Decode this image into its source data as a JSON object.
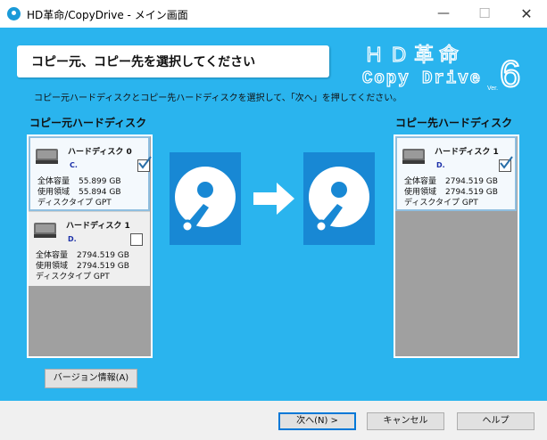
{
  "window": {
    "title": "HD革命/CopyDrive - メイン画面",
    "min_glyph": "—",
    "max_glyph": "☐",
    "close_glyph": "✕"
  },
  "heading": "コピー元、コピー先を選択してください",
  "logo": {
    "line1": "ＨＤ革命",
    "line2": "Copy Drive",
    "ver": "Ver.",
    "version": "6"
  },
  "instruction": "コピー元ハードディスクとコピー先ハードディスクを選択して、「次へ」を押してください。",
  "source": {
    "title": "コピー元ハードディスク",
    "disks": [
      {
        "name": "ハードディスク 0",
        "letter": "C.",
        "checked": true,
        "total_label": "全体容量",
        "total": "55.899 GB",
        "used_label": "使用領域",
        "used": "55.894 GB",
        "type_label": "ディスクタイプ",
        "type": "GPT"
      },
      {
        "name": "ハードディスク 1",
        "letter": "D.",
        "checked": false,
        "total_label": "全体容量",
        "total": "2794.519 GB",
        "used_label": "使用領域",
        "used": "2794.519 GB",
        "type_label": "ディスクタイプ",
        "type": "GPT"
      }
    ]
  },
  "target": {
    "title": "コピー先ハードディスク",
    "disks": [
      {
        "name": "ハードディスク 1",
        "letter": "D.",
        "checked": true,
        "total_label": "全体容量",
        "total": "2794.519 GB",
        "used_label": "使用領域",
        "used": "2794.519 GB",
        "type_label": "ディスクタイプ",
        "type": "GPT"
      }
    ]
  },
  "buttons": {
    "version": "バージョン情報(A)",
    "next": "次へ(N) >",
    "cancel": "キャンセル",
    "help": "ヘルプ"
  },
  "colors": {
    "background": "#2ab4ee",
    "disk_tile": "#1888d4",
    "panel": "#a0a0a0",
    "check": "#2a6fa8"
  }
}
